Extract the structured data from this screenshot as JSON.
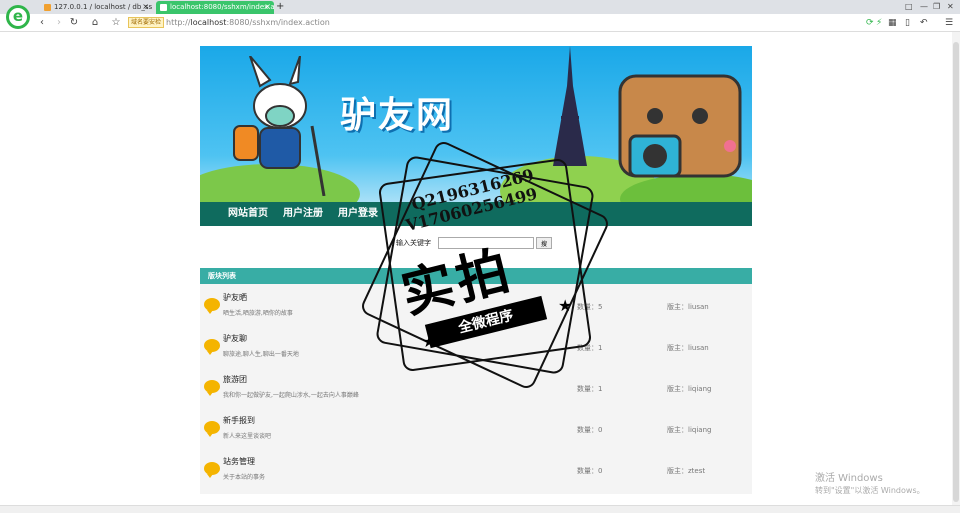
{
  "browser": {
    "logo_letter": "e",
    "tabs": [
      {
        "title": "127.0.0.1 / localhost / db_ss",
        "close": "×"
      },
      {
        "title": "localhost:8080/sshxm/index.a",
        "close": "×"
      }
    ],
    "new_tab": "+",
    "secure_badge": "域名要安检",
    "url_host": "localhost",
    "url_prefix": "http://",
    "url_rest": ":8080/sshxm/index.action",
    "window_controls": [
      "□",
      "—",
      "❐",
      "✕"
    ]
  },
  "site": {
    "banner_title": "驴友网",
    "nav": [
      "网站首页",
      "用户注册",
      "用户登录"
    ],
    "search": {
      "label": "输入关键字",
      "placeholder": "",
      "button": "搜"
    },
    "section_title": "版块列表",
    "boards": [
      {
        "name": "驴友晒",
        "desc": "晒生活,晒旅游,晒你的故事",
        "count_label": "数量：",
        "count": "5",
        "admin_label": "版主：",
        "admin": "liusan"
      },
      {
        "name": "驴友聊",
        "desc": "聊旅途,聊人生,聊出一番天地",
        "count_label": "数量：",
        "count": "1",
        "admin_label": "版主：",
        "admin": "liusan"
      },
      {
        "name": "旅游团",
        "desc": "我和你一起做驴友,一起爬山涉水,一起去向人事巅峰",
        "count_label": "数量：",
        "count": "1",
        "admin_label": "版主：",
        "admin": "liqiang"
      },
      {
        "name": "新手报到",
        "desc": "新人来这里谈谈吧",
        "count_label": "数量：",
        "count": "0",
        "admin_label": "版主：",
        "admin": "liqiang"
      },
      {
        "name": "站务管理",
        "desc": "关于本站的事务",
        "count_label": "数量：",
        "count": "0",
        "admin_label": "版主：",
        "admin": "ztest"
      }
    ]
  },
  "watermark": {
    "line1": "Q2196316269",
    "line2": "V17060256499",
    "big": "实拍",
    "ribbon": "全微程序"
  },
  "windows_activation": {
    "title": "激活 Windows",
    "subtitle": "转到\"设置\"以激活 Windows。"
  },
  "colors": {
    "nav_bg": "#0f6b5e",
    "section_header": "#38ada5",
    "active_tab": "#3ac56b"
  }
}
